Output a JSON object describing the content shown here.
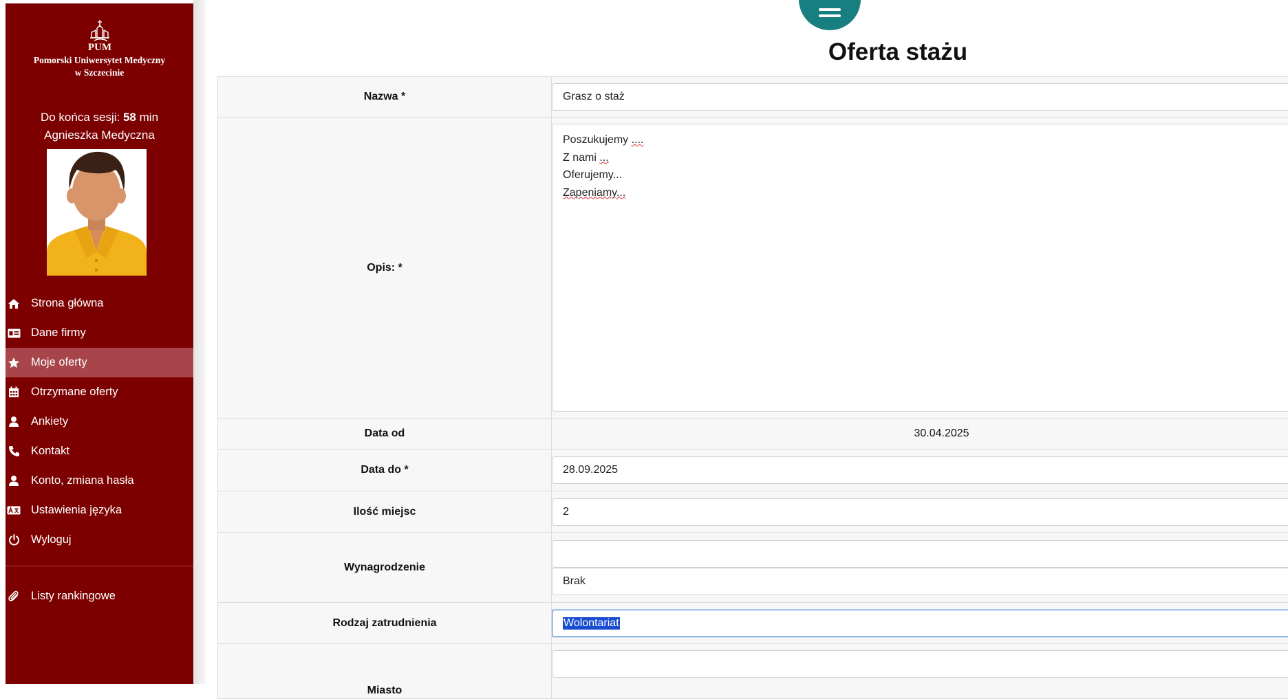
{
  "sidebar": {
    "university_abbr": "PUM",
    "university_line1": "Pomorski Uniwersytet Medyczny",
    "university_line2": "w Szczecinie",
    "session_prefix": "Do końca sesji:",
    "session_minutes": "58",
    "session_unit": "min",
    "user_name": "Agnieszka Medyczna",
    "nav_items": [
      {
        "label": "Strona główna",
        "icon": "home-icon"
      },
      {
        "label": "Dane firmy",
        "icon": "id-card-icon"
      },
      {
        "label": "Moje oferty",
        "icon": "star-icon",
        "active": true
      },
      {
        "label": "Otrzymane oferty",
        "icon": "calendar-icon"
      },
      {
        "label": "Ankiety",
        "icon": "user-icon"
      },
      {
        "label": "Kontakt",
        "icon": "phone-icon"
      },
      {
        "label": "Konto, zmiana hasła",
        "icon": "user-icon"
      },
      {
        "label": "Ustawienia języka",
        "icon": "language-icon"
      },
      {
        "label": "Wyloguj",
        "icon": "power-icon"
      }
    ],
    "extra_item": {
      "label": "Listy rankingowe",
      "icon": "paperclip-icon"
    }
  },
  "page": {
    "title": "Oferta stażu"
  },
  "form": {
    "name_label": "Nazwa *",
    "name_value": "Grasz o staż",
    "description_label": "Opis: *",
    "description_lines": [
      "Poszukujemy ....",
      "Z nami ...",
      "Oferujemy...",
      "Zapeniamy..."
    ],
    "date_from_label": "Data od",
    "date_from_value": "30.04.2025",
    "date_to_label": "Data do *",
    "date_to_value": "28.09.2025",
    "places_label": "Ilość miejsc",
    "places_value": "2",
    "salary_label": "Wynagrodzenie",
    "salary_value": "",
    "salary_select_value": "Brak",
    "employment_label": "Rodzaj zatrudnienia",
    "employment_value": "Wolontariat",
    "city_label": "Miasto",
    "city_value": ""
  },
  "colors": {
    "sidebar_bg": "#7d0000",
    "sidebar_active": "#a8454a",
    "accent_teal": "#177f80",
    "focus_blue": "#3b7ad9"
  }
}
